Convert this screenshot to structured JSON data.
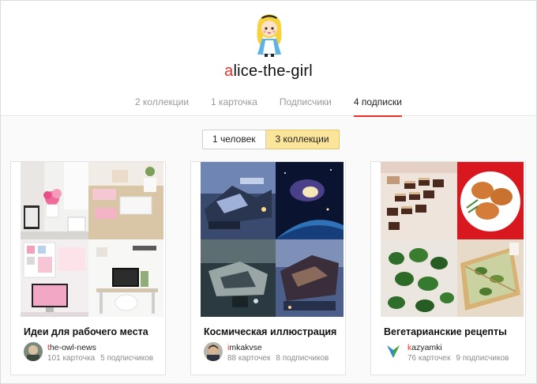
{
  "profile": {
    "username_first_letter": "a",
    "username_rest": "lice-the-girl",
    "avatar_icon": "alice-avatar-icon"
  },
  "tabs": [
    {
      "label": "2 коллекции"
    },
    {
      "label": "1 карточка"
    },
    {
      "label": "Подписчики"
    },
    {
      "label": "4 подписки"
    }
  ],
  "active_tab": "4 подписки",
  "filter": {
    "people_label": "1 человек",
    "collections_label": "3 коллекции",
    "selected": "3 коллекции"
  },
  "colors": {
    "accent_red": "#e8312a",
    "selected_toggle": "#fbe59a"
  },
  "cards": [
    {
      "title": "Идеи для рабочего места",
      "author_first": "t",
      "author_rest": "he-owl-news",
      "cards_count": "101 карточка",
      "subscribers": "5 подписчиков"
    },
    {
      "title": "Космическая иллюстрация",
      "author_first": "i",
      "author_rest": "mkakvse",
      "cards_count": "88 карточек",
      "subscribers": "8 подписчиков"
    },
    {
      "title": "Вегетарианские рецепты",
      "author_first": "k",
      "author_rest": "azyamki",
      "cards_count": "76 карточек",
      "subscribers": "9 подписчиков"
    }
  ]
}
